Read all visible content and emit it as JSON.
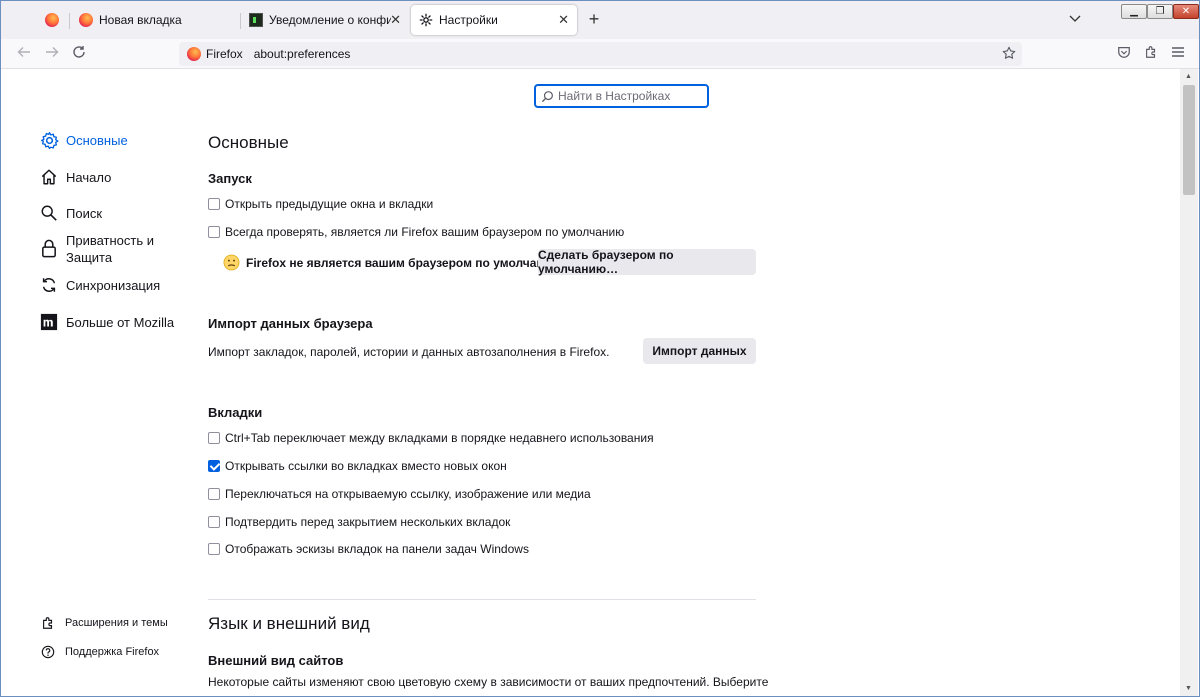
{
  "browser": {
    "tabs": [
      {
        "label": "",
        "icon": "firefox-logo"
      },
      {
        "label": "Новая вкладка",
        "icon": "firefox-logo"
      },
      {
        "label": "Уведомление о конфиденциа",
        "icon": "terminal-icon"
      },
      {
        "label": "Настройки",
        "icon": "gear-icon",
        "active": true
      }
    ],
    "identity_label": "Firefox",
    "url": "about:preferences"
  },
  "search": {
    "placeholder": "Найти в Настройках"
  },
  "sidebar": {
    "items": [
      {
        "label": "Основные",
        "icon": "gear-icon",
        "active": true
      },
      {
        "label": "Начало",
        "icon": "home-icon"
      },
      {
        "label": "Поиск",
        "icon": "search-icon"
      },
      {
        "label": "Приватность и Защита",
        "icon": "lock-icon"
      },
      {
        "label": "Синхронизация",
        "icon": "sync-icon"
      },
      {
        "label": "Больше от Mozilla",
        "icon": "mozilla-icon"
      }
    ],
    "footer": [
      {
        "label": "Расширения и темы",
        "icon": "puzzle-icon"
      },
      {
        "label": "Поддержка Firefox",
        "icon": "help-icon"
      }
    ]
  },
  "main": {
    "title": "Основные",
    "startup": {
      "heading": "Запуск",
      "restore_session": {
        "label": "Открыть предыдущие окна и вкладки",
        "checked": false
      },
      "check_default": {
        "label": "Всегда проверять, является ли Firefox вашим браузером по умолчанию",
        "checked": false
      },
      "default_status": "Firefox не является вашим браузером по умолчанию",
      "make_default_button": "Сделать браузером по умолчанию…"
    },
    "import": {
      "heading": "Импорт данных браузера",
      "description": "Импорт закладок, паролей, истории и данных автозаполнения в Firefox.",
      "button": "Импорт данных"
    },
    "tabs_section": {
      "heading": "Вкладки",
      "options": [
        {
          "label": "Ctrl+Tab переключает между вкладками в порядке недавнего использования",
          "checked": false
        },
        {
          "label": "Открывать ссылки во вкладках вместо новых окон",
          "checked": true
        },
        {
          "label": "Переключаться на открываемую ссылку, изображение или медиа",
          "checked": false
        },
        {
          "label": "Подтвердить перед закрытием нескольких вкладок",
          "checked": false
        },
        {
          "label": "Отображать эскизы вкладок на панели задач Windows",
          "checked": false
        }
      ]
    },
    "language_appearance": {
      "title": "Язык и внешний вид",
      "website_appearance_heading": "Внешний вид сайтов",
      "website_appearance_text": "Некоторые сайты изменяют свою цветовую схему в зависимости от ваших предпочтений. Выберите"
    }
  },
  "colors": {
    "accent": "#0061e0",
    "text": "#15141a",
    "button_bg": "#e8e8ed"
  }
}
